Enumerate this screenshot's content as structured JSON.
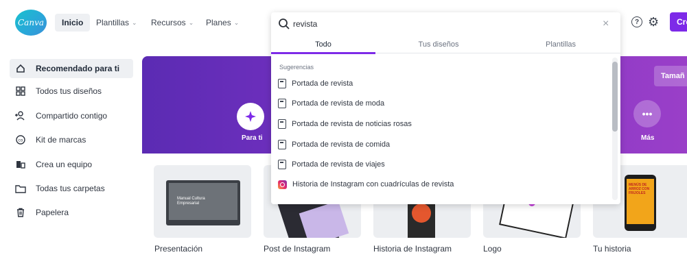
{
  "header": {
    "logo_text": "Canva",
    "nav": [
      {
        "label": "Inicio"
      },
      {
        "label": "Plantillas"
      },
      {
        "label": "Recursos"
      },
      {
        "label": "Planes"
      }
    ],
    "create_label": "Cre"
  },
  "search": {
    "value": "revista",
    "tabs": [
      {
        "label": "Todo"
      },
      {
        "label": "Tus diseños"
      },
      {
        "label": "Plantillas"
      }
    ],
    "suggestions_heading": "Sugerencias",
    "suggestions": [
      {
        "label": "Portada de revista",
        "icon": "document-icon"
      },
      {
        "label": "Portada de revista de moda",
        "icon": "document-icon"
      },
      {
        "label": "Portada de revista de noticias rosas",
        "icon": "document-icon"
      },
      {
        "label": "Portada de revista de comida",
        "icon": "document-icon"
      },
      {
        "label": "Portada de revista de viajes",
        "icon": "document-icon"
      },
      {
        "label": "Historia de Instagram con cuadrículas de revista",
        "icon": "instagram-icon"
      }
    ]
  },
  "sidebar": {
    "items": [
      {
        "label": "Recomendado para ti"
      },
      {
        "label": "Todos tus diseños"
      },
      {
        "label": "Compartido contigo"
      },
      {
        "label": "Kit de marcas"
      },
      {
        "label": "Crea un equipo"
      },
      {
        "label": "Todas tus carpetas"
      },
      {
        "label": "Papelera"
      }
    ]
  },
  "hero": {
    "for_you_label": "Para ti",
    "more_label": "Más",
    "size_label": "Tamañ"
  },
  "cards": [
    {
      "label": "Presentación",
      "thumb_title": "Manual Cultura Empresarial"
    },
    {
      "label": "Post de Instagram"
    },
    {
      "label": "Historia de Instagram"
    },
    {
      "label": "Logo"
    },
    {
      "label": "Tu historia",
      "thumb_title": "MENÚS DE ARROZ CON FRIJOLES"
    }
  ],
  "colors": {
    "accent": "#7d2ae8",
    "hero_start": "#5b2bb3",
    "hero_end": "#9a3fc8"
  }
}
